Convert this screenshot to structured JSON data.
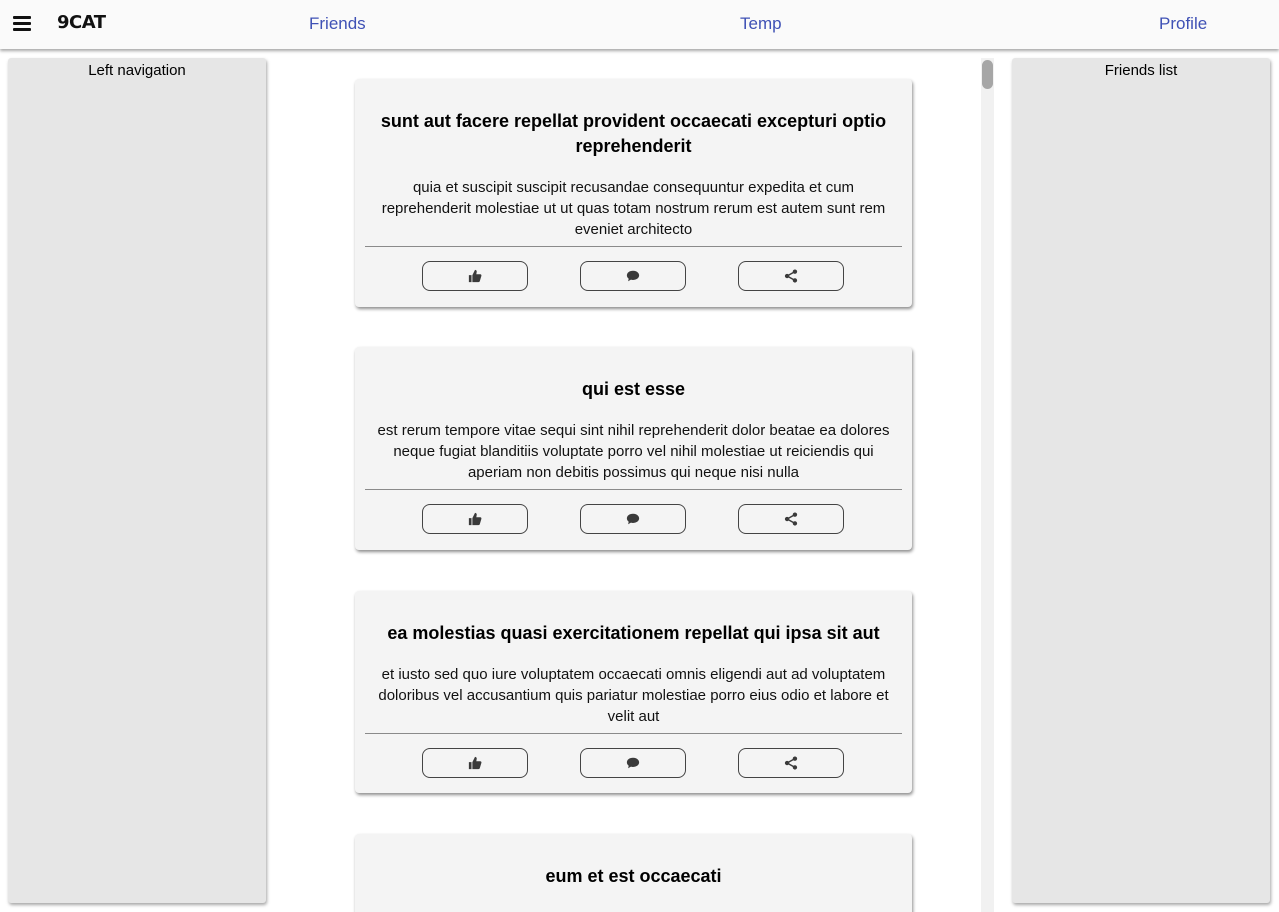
{
  "header": {
    "brand": "9CAT",
    "nav": {
      "friends": "Friends",
      "temp": "Temp",
      "profile": "Profile"
    }
  },
  "left_panel": {
    "title": "Left navigation"
  },
  "right_panel": {
    "title": "Friends list"
  },
  "colors": {
    "nav_link": "#3f51b5",
    "panel_bg": "#e6e6e6",
    "card_bg": "#f4f4f4"
  },
  "posts": [
    {
      "title": "sunt aut facere repellat provident occaecati excepturi optio reprehenderit",
      "body": "quia et suscipit suscipit recusandae consequuntur expedita et cum reprehenderit molestiae ut ut quas totam nostrum rerum est autem sunt rem eveniet architecto"
    },
    {
      "title": "qui est esse",
      "body": "est rerum tempore vitae sequi sint nihil reprehenderit dolor beatae ea dolores neque fugiat blanditiis voluptate porro vel nihil molestiae ut reiciendis qui aperiam non debitis possimus qui neque nisi nulla"
    },
    {
      "title": "ea molestias quasi exercitationem repellat qui ipsa sit aut",
      "body": "et iusto sed quo iure voluptatem occaecati omnis eligendi aut ad voluptatem doloribus vel accusantium quis pariatur molestiae porro eius odio et labore et velit aut"
    },
    {
      "title": "eum et est occaecati",
      "body": ""
    }
  ],
  "icons": {
    "like": "thumbs-up-icon",
    "comment": "comment-icon",
    "share": "share-icon",
    "menu": "hamburger-menu-icon"
  }
}
